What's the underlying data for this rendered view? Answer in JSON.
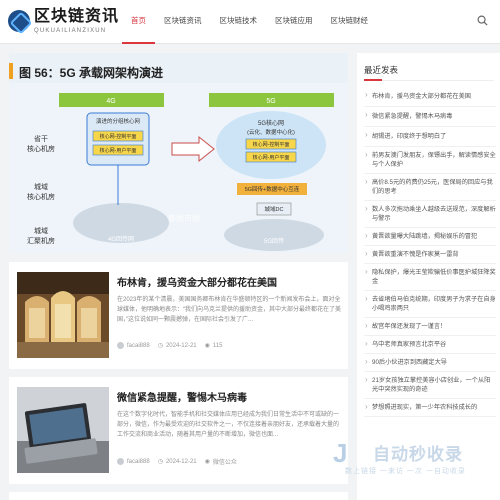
{
  "site": {
    "logo_title": "区块链资讯",
    "logo_sub": "QUKUAILIANZIXUN"
  },
  "nav": [
    {
      "label": "首页",
      "active": true
    },
    {
      "label": "区块链资讯",
      "active": false
    },
    {
      "label": "区块链技术",
      "active": false
    },
    {
      "label": "区块链应用",
      "active": false
    },
    {
      "label": "区块链财经",
      "active": false
    }
  ],
  "hero": {
    "title": "图 56：5G 承载网架构演进",
    "labels": {
      "g4": "4G",
      "g5": "5G",
      "prov_core": "省干\n核心机房",
      "city_core": "城域\n核心机房",
      "city_agg": "城域\n汇聚机房",
      "core_net_4g": "演进的分组核心网",
      "core_ctrl": "核心网-控制平面",
      "core_user": "核心网-用户平面",
      "core_net_5g": "5G核心网\n(云化、数据中心化)",
      "core_ctrl_5g": "核心网-控制平面",
      "core_user_5g": "核心网-用户平面",
      "return_5g": "5G回传+数据中心互连",
      "city_dc": "城域DC",
      "ring": "4G回传网",
      "ring_5g": "5G回传",
      "watermark": "泰国市圈"
    }
  },
  "articles": [
    {
      "title": "布林肯，援乌资金大部分都花在美国",
      "excerpt": "在2023年的某个清晨，美国国务卿布林肯在华盛顿特区的一个新闻发布会上，面对全球媒体，他明确地表示：“我们向乌克兰提供的援助资金，其中大部分最终都花在了美国，”这位说如同一颗震撼弹，在国际社会引发了广...",
      "author": "facai888",
      "date": "2024-12-21",
      "views": "115"
    },
    {
      "title": "微信紧急提醒，警惕木马病毒",
      "excerpt": "在这个数字化时代，智能手机和社交媒体应用已经成为我们日常生活中不可或缺的一部分，微信，作为最受欢迎的社交软件之一，不仅连接着亲朋好友，还承载着大量的工作交流和商业活动，随着其用户量的不断增加，微信也面...",
      "author": "facai888",
      "date": "2024-12-21",
      "views": "微信公众"
    }
  ],
  "sidebar": {
    "heading": "最近发表",
    "items": [
      "布林肯，援乌资金大部分都花在美国",
      "微信紧急提醒，警惕木马病毒",
      "胡锡进，印度终于想明白了",
      "前男友澳门发朋友，保镖出手，解读情感安全与个人保护",
      "高价8.5元的药费仍25元，医保局的回应与我们的思考",
      "数人多次拖动乘坐人越级去送规范，深度解析与警示",
      "黄晋欲量曝大陆跳墙，揭秘娱乐的冒犯",
      "黄晋欲重演不愧是作家莫一雷背",
      "隐私保护，爆光王莹欺骗低价事医护城狂降奖金",
      "去省堵伯马伯克统期，印度男子为求子在自身小喝鸡崇两只",
      "故宫年保还发现了一谨言！",
      "乌中老师真家预言北京平谷",
      "90后小伙进京到西藏定大导",
      "21岁女孩独立掌控美容小店创业，一个从阳光中突然实现的奇迹",
      "梦想照进现实，第一少年农科技成长的"
    ]
  },
  "badge": {
    "mark": "J",
    "title": "自动秒收录",
    "sub": "数上链接 一来访 一次 一自动收录"
  }
}
